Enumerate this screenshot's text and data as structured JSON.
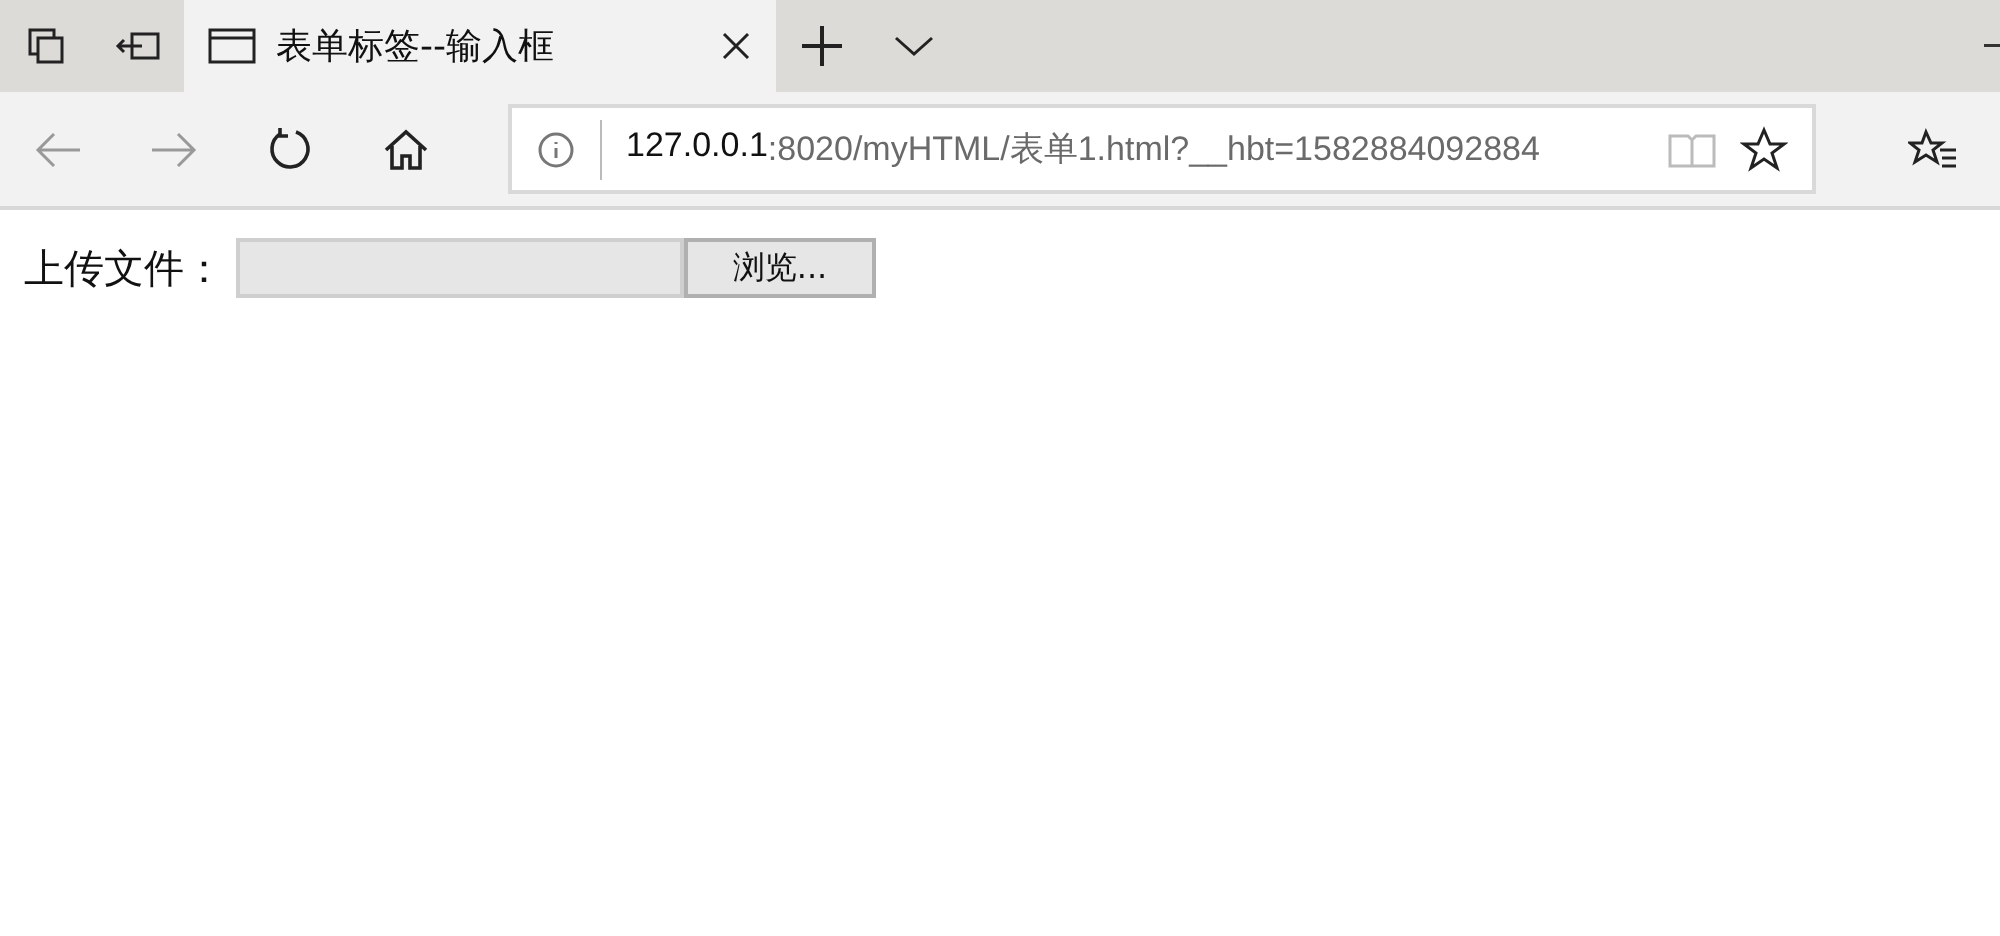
{
  "tabs": [
    {
      "title": "表单标签--输入框",
      "selected": true
    }
  ],
  "address_bar": {
    "host": "127.0.0.1",
    "rest": ":8020/myHTML/表单1.html?__hbt=1582884092884"
  },
  "page": {
    "label": "上传文件：",
    "browse_button": "浏览..."
  }
}
